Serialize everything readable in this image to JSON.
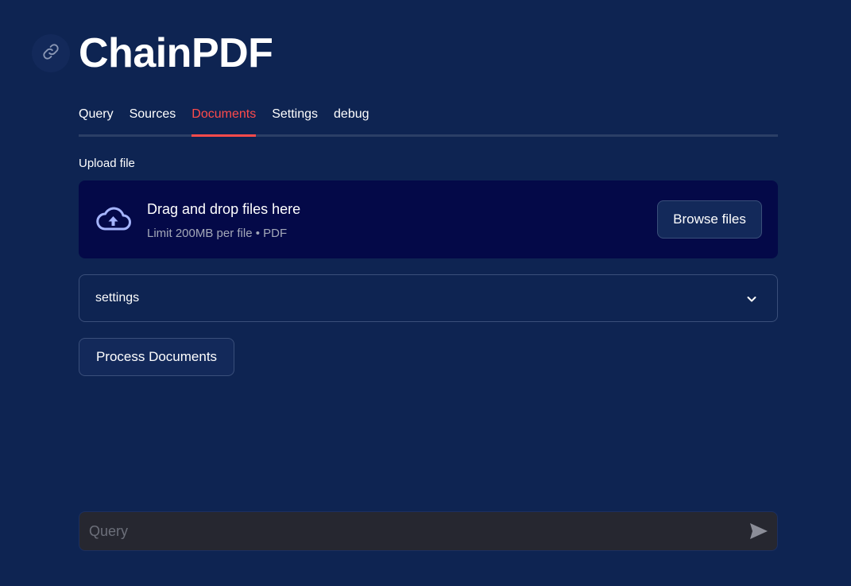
{
  "app": {
    "title": "ChainPDF",
    "title_icon": "link-icon"
  },
  "tabs": [
    {
      "label": "Query",
      "active": false
    },
    {
      "label": "Sources",
      "active": false
    },
    {
      "label": "Documents",
      "active": true
    },
    {
      "label": "Settings",
      "active": false
    },
    {
      "label": "debug",
      "active": false
    }
  ],
  "upload": {
    "label": "Upload file",
    "icon": "cloud-upload-icon",
    "drop_title": "Drag and drop files here",
    "limit_text": "Limit 200MB per file • PDF",
    "browse_label": "Browse files"
  },
  "expander": {
    "label": "settings",
    "icon": "chevron-down-icon"
  },
  "process_button": {
    "label": "Process Documents"
  },
  "chat": {
    "placeholder": "Query",
    "value": "",
    "send_icon": "send-icon"
  },
  "colors": {
    "background": "#0e2452",
    "accent": "#ff4b4b",
    "dropzone": "#040948",
    "chat_input": "#262730"
  }
}
